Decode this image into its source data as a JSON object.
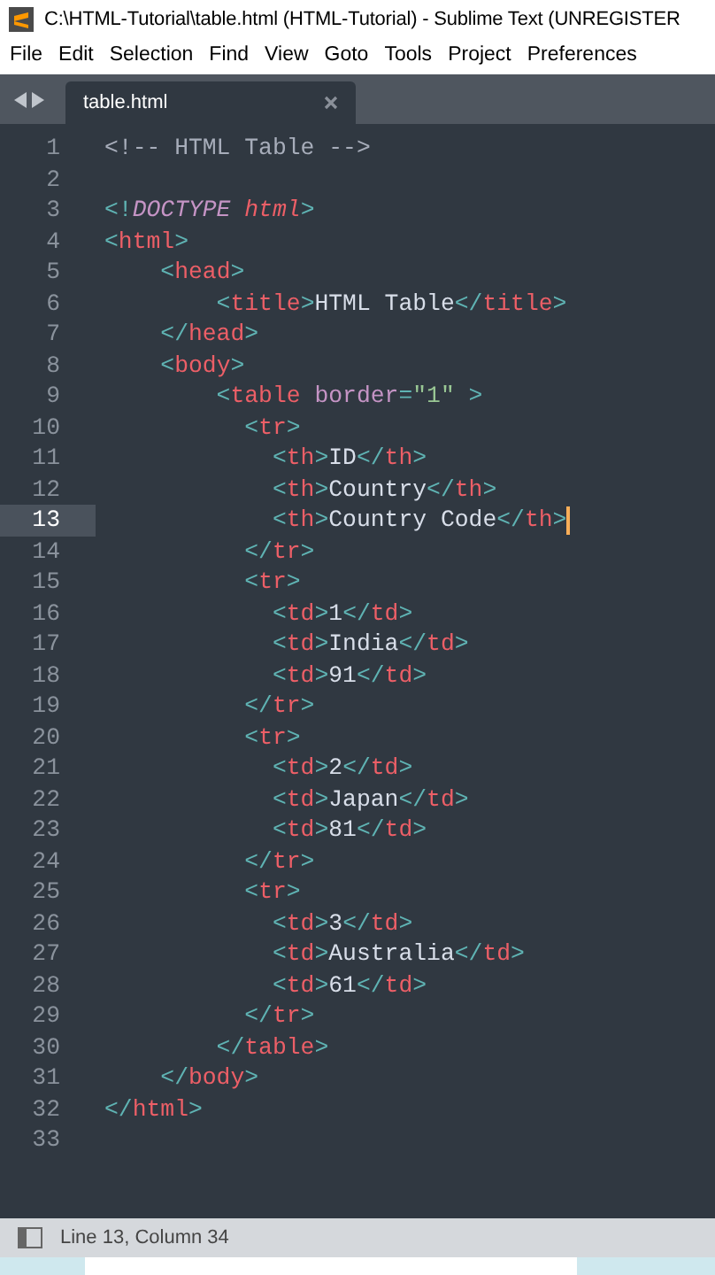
{
  "window": {
    "title": "C:\\HTML-Tutorial\\table.html (HTML-Tutorial) - Sublime Text (UNREGISTER"
  },
  "menu": [
    "File",
    "Edit",
    "Selection",
    "Find",
    "View",
    "Goto",
    "Tools",
    "Project",
    "Preferences"
  ],
  "tabs": [
    {
      "label": "table.html",
      "selected": true
    }
  ],
  "lines": [
    {
      "number": "1",
      "current": false,
      "tokens": [
        {
          "kind": "comment",
          "text": "<!-- HTML Table -->"
        }
      ]
    },
    {
      "number": "2",
      "current": false
    },
    {
      "number": "3",
      "current": false,
      "tokens": [
        {
          "kind": "punct",
          "text": "<!"
        },
        {
          "kind": "doctype",
          "text": "DOCTYPE"
        },
        {
          "kind": "doctype-name",
          "text": " html"
        },
        {
          "kind": "punct",
          "text": ">"
        }
      ]
    },
    {
      "number": "4",
      "current": false,
      "tokens": [
        {
          "kind": "punct",
          "text": "<"
        },
        {
          "kind": "tag",
          "text": "html"
        },
        {
          "kind": "punct",
          "text": ">"
        }
      ]
    },
    {
      "number": "5",
      "current": false,
      "tokens": [
        {
          "kind": "punct",
          "text": "    <"
        },
        {
          "kind": "tag",
          "text": "head"
        },
        {
          "kind": "punct",
          "text": ">"
        }
      ]
    },
    {
      "number": "6",
      "current": false,
      "tokens": [
        {
          "kind": "punct",
          "text": "        <"
        },
        {
          "kind": "tag",
          "text": "title"
        },
        {
          "kind": "punct",
          "text": ">"
        },
        {
          "kind": "text",
          "text": "HTML Table"
        },
        {
          "kind": "punct",
          "text": "</"
        },
        {
          "kind": "tag",
          "text": "title"
        },
        {
          "kind": "punct",
          "text": ">"
        }
      ]
    },
    {
      "number": "7",
      "current": false,
      "tokens": [
        {
          "kind": "punct",
          "text": "    </"
        },
        {
          "kind": "tag",
          "text": "head"
        },
        {
          "kind": "punct",
          "text": ">"
        }
      ]
    },
    {
      "number": "8",
      "current": false,
      "tokens": [
        {
          "kind": "punct",
          "text": "    <"
        },
        {
          "kind": "tag",
          "text": "body"
        },
        {
          "kind": "punct",
          "text": ">"
        }
      ]
    },
    {
      "number": "9",
      "current": false,
      "tokens": [
        {
          "kind": "punct",
          "text": "        <"
        },
        {
          "kind": "tag",
          "text": "table"
        },
        {
          "kind": "attr",
          "text": " border"
        },
        {
          "kind": "punct",
          "text": "="
        },
        {
          "kind": "string",
          "text": "\"1\""
        },
        {
          "kind": "punct",
          "text": " >"
        }
      ]
    },
    {
      "number": "10",
      "current": false,
      "tokens": [
        {
          "kind": "punct",
          "text": "          <"
        },
        {
          "kind": "tag",
          "text": "tr"
        },
        {
          "kind": "punct",
          "text": ">"
        }
      ]
    },
    {
      "number": "11",
      "current": false,
      "tokens": [
        {
          "kind": "punct",
          "text": "            <"
        },
        {
          "kind": "tag",
          "text": "th"
        },
        {
          "kind": "punct",
          "text": ">"
        },
        {
          "kind": "text",
          "text": "ID"
        },
        {
          "kind": "punct",
          "text": "</"
        },
        {
          "kind": "tag",
          "text": "th"
        },
        {
          "kind": "punct",
          "text": ">"
        }
      ]
    },
    {
      "number": "12",
      "current": false,
      "tokens": [
        {
          "kind": "punct",
          "text": "            <"
        },
        {
          "kind": "tag",
          "text": "th"
        },
        {
          "kind": "punct",
          "text": ">"
        },
        {
          "kind": "text",
          "text": "Country"
        },
        {
          "kind": "punct",
          "text": "</"
        },
        {
          "kind": "tag",
          "text": "th"
        },
        {
          "kind": "punct",
          "text": ">"
        }
      ]
    },
    {
      "number": "13",
      "current": true,
      "tokens": [
        {
          "kind": "punct",
          "text": "            <"
        },
        {
          "kind": "tag",
          "text": "th"
        },
        {
          "kind": "punct",
          "text": ">"
        },
        {
          "kind": "text",
          "text": "Country Code"
        },
        {
          "kind": "punct",
          "text": "</"
        },
        {
          "kind": "tag",
          "text": "th"
        },
        {
          "kind": "punct",
          "text": ">"
        }
      ]
    },
    {
      "number": "14",
      "current": false,
      "tokens": [
        {
          "kind": "punct",
          "text": "          </"
        },
        {
          "kind": "tag",
          "text": "tr"
        },
        {
          "kind": "punct",
          "text": ">"
        }
      ]
    },
    {
      "number": "15",
      "current": false,
      "tokens": [
        {
          "kind": "punct",
          "text": "          <"
        },
        {
          "kind": "tag",
          "text": "tr"
        },
        {
          "kind": "punct",
          "text": ">"
        }
      ]
    },
    {
      "number": "16",
      "current": false,
      "tokens": [
        {
          "kind": "punct",
          "text": "            <"
        },
        {
          "kind": "tag",
          "text": "td"
        },
        {
          "kind": "punct",
          "text": ">"
        },
        {
          "kind": "text",
          "text": "1"
        },
        {
          "kind": "punct",
          "text": "</"
        },
        {
          "kind": "tag",
          "text": "td"
        },
        {
          "kind": "punct",
          "text": ">"
        }
      ]
    },
    {
      "number": "17",
      "current": false,
      "tokens": [
        {
          "kind": "punct",
          "text": "            <"
        },
        {
          "kind": "tag",
          "text": "td"
        },
        {
          "kind": "punct",
          "text": ">"
        },
        {
          "kind": "text",
          "text": "India"
        },
        {
          "kind": "punct",
          "text": "</"
        },
        {
          "kind": "tag",
          "text": "td"
        },
        {
          "kind": "punct",
          "text": ">"
        }
      ]
    },
    {
      "number": "18",
      "current": false,
      "tokens": [
        {
          "kind": "punct",
          "text": "            <"
        },
        {
          "kind": "tag",
          "text": "td"
        },
        {
          "kind": "punct",
          "text": ">"
        },
        {
          "kind": "text",
          "text": "91"
        },
        {
          "kind": "punct",
          "text": "</"
        },
        {
          "kind": "tag",
          "text": "td"
        },
        {
          "kind": "punct",
          "text": ">"
        }
      ]
    },
    {
      "number": "19",
      "current": false,
      "tokens": [
        {
          "kind": "punct",
          "text": "          </"
        },
        {
          "kind": "tag",
          "text": "tr"
        },
        {
          "kind": "punct",
          "text": ">"
        }
      ]
    },
    {
      "number": "20",
      "current": false,
      "tokens": [
        {
          "kind": "punct",
          "text": "          <"
        },
        {
          "kind": "tag",
          "text": "tr"
        },
        {
          "kind": "punct",
          "text": ">"
        }
      ]
    },
    {
      "number": "21",
      "current": false,
      "tokens": [
        {
          "kind": "punct",
          "text": "            <"
        },
        {
          "kind": "tag",
          "text": "td"
        },
        {
          "kind": "punct",
          "text": ">"
        },
        {
          "kind": "text",
          "text": "2"
        },
        {
          "kind": "punct",
          "text": "</"
        },
        {
          "kind": "tag",
          "text": "td"
        },
        {
          "kind": "punct",
          "text": ">"
        }
      ]
    },
    {
      "number": "22",
      "current": false,
      "tokens": [
        {
          "kind": "punct",
          "text": "            <"
        },
        {
          "kind": "tag",
          "text": "td"
        },
        {
          "kind": "punct",
          "text": ">"
        },
        {
          "kind": "text",
          "text": "Japan"
        },
        {
          "kind": "punct",
          "text": "</"
        },
        {
          "kind": "tag",
          "text": "td"
        },
        {
          "kind": "punct",
          "text": ">"
        }
      ]
    },
    {
      "number": "23",
      "current": false,
      "tokens": [
        {
          "kind": "punct",
          "text": "            <"
        },
        {
          "kind": "tag",
          "text": "td"
        },
        {
          "kind": "punct",
          "text": ">"
        },
        {
          "kind": "text",
          "text": "81"
        },
        {
          "kind": "punct",
          "text": "</"
        },
        {
          "kind": "tag",
          "text": "td"
        },
        {
          "kind": "punct",
          "text": ">"
        }
      ]
    },
    {
      "number": "24",
      "current": false,
      "tokens": [
        {
          "kind": "punct",
          "text": "          </"
        },
        {
          "kind": "tag",
          "text": "tr"
        },
        {
          "kind": "punct",
          "text": ">"
        }
      ]
    },
    {
      "number": "25",
      "current": false,
      "tokens": [
        {
          "kind": "punct",
          "text": "          <"
        },
        {
          "kind": "tag",
          "text": "tr"
        },
        {
          "kind": "punct",
          "text": ">"
        }
      ]
    },
    {
      "number": "26",
      "current": false,
      "tokens": [
        {
          "kind": "punct",
          "text": "            <"
        },
        {
          "kind": "tag",
          "text": "td"
        },
        {
          "kind": "punct",
          "text": ">"
        },
        {
          "kind": "text",
          "text": "3"
        },
        {
          "kind": "punct",
          "text": "</"
        },
        {
          "kind": "tag",
          "text": "td"
        },
        {
          "kind": "punct",
          "text": ">"
        }
      ]
    },
    {
      "number": "27",
      "current": false,
      "tokens": [
        {
          "kind": "punct",
          "text": "            <"
        },
        {
          "kind": "tag",
          "text": "td"
        },
        {
          "kind": "punct",
          "text": ">"
        },
        {
          "kind": "text",
          "text": "Australia"
        },
        {
          "kind": "punct",
          "text": "</"
        },
        {
          "kind": "tag",
          "text": "td"
        },
        {
          "kind": "punct",
          "text": ">"
        }
      ]
    },
    {
      "number": "28",
      "current": false,
      "tokens": [
        {
          "kind": "punct",
          "text": "            <"
        },
        {
          "kind": "tag",
          "text": "td"
        },
        {
          "kind": "punct",
          "text": ">"
        },
        {
          "kind": "text",
          "text": "61"
        },
        {
          "kind": "punct",
          "text": "</"
        },
        {
          "kind": "tag",
          "text": "td"
        },
        {
          "kind": "punct",
          "text": ">"
        }
      ]
    },
    {
      "number": "29",
      "current": false,
      "tokens": [
        {
          "kind": "punct",
          "text": "          </"
        },
        {
          "kind": "tag",
          "text": "tr"
        },
        {
          "kind": "punct",
          "text": ">"
        }
      ]
    },
    {
      "number": "30",
      "current": false,
      "tokens": [
        {
          "kind": "punct",
          "text": "        </"
        },
        {
          "kind": "tag",
          "text": "table"
        },
        {
          "kind": "punct",
          "text": ">"
        }
      ]
    },
    {
      "number": "31",
      "current": false,
      "tokens": [
        {
          "kind": "punct",
          "text": "    </"
        },
        {
          "kind": "tag",
          "text": "body"
        },
        {
          "kind": "punct",
          "text": ">"
        }
      ]
    },
    {
      "number": "32",
      "current": false,
      "tokens": [
        {
          "kind": "punct",
          "text": "</"
        },
        {
          "kind": "tag",
          "text": "html"
        },
        {
          "kind": "punct",
          "text": ">"
        }
      ]
    },
    {
      "number": "33",
      "current": false
    }
  ],
  "status_bar": {
    "text": "Line 13, Column 34"
  }
}
